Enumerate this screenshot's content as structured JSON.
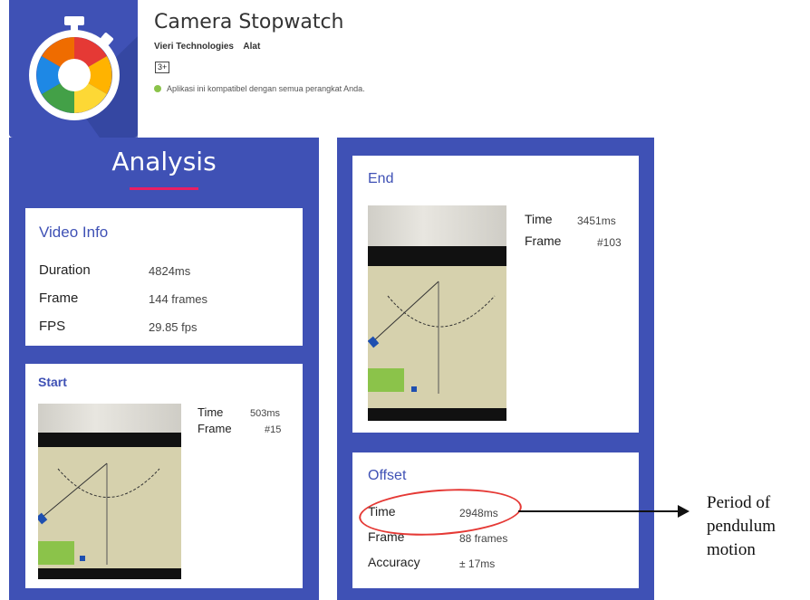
{
  "app": {
    "title": "Camera Stopwatch",
    "developer": "Vieri Technologies",
    "category": "Alat",
    "rating_badge": "3+",
    "compat_text": "Aplikasi ini kompatibel dengan semua perangkat Anda.",
    "icon": "stopwatch-aperture-icon"
  },
  "analysis": {
    "title": "Analysis",
    "video_info": {
      "title": "Video Info",
      "rows": [
        {
          "label": "Duration",
          "value": "4824ms"
        },
        {
          "label": "Frame",
          "value": "144 frames"
        },
        {
          "label": "FPS",
          "value": "29.85 fps"
        }
      ]
    },
    "start": {
      "title": "Start",
      "time_label": "Time",
      "time_value": "503ms",
      "frame_label": "Frame",
      "frame_value": "#15"
    },
    "end": {
      "title": "End",
      "time_label": "Time",
      "time_value": "3451ms",
      "frame_label": "Frame",
      "frame_value": "#103"
    },
    "offset": {
      "title": "Offset",
      "rows": [
        {
          "label": "Time",
          "value": "2948ms"
        },
        {
          "label": "Frame",
          "value": "88 frames"
        },
        {
          "label": "Accuracy",
          "value": "± 17ms"
        }
      ]
    }
  },
  "annotation": {
    "line1": "Period of",
    "line2": "pendulum",
    "line3": "motion"
  },
  "colors": {
    "panel": "#3f51b5",
    "accent": "#e91e63",
    "annotation": "#e53935"
  }
}
